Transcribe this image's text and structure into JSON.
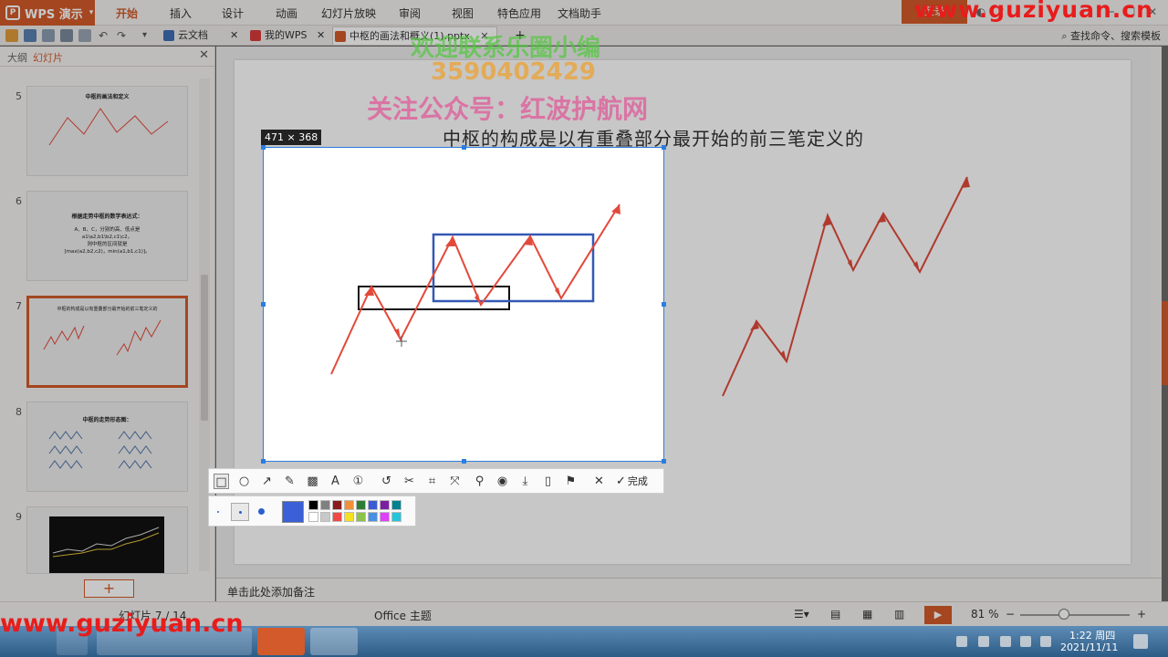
{
  "app": {
    "name": "WPS 演示"
  },
  "menu": {
    "items": [
      "开始",
      "插入",
      "设计",
      "动画",
      "幻灯片放映",
      "审阅",
      "视图",
      "特色应用",
      "文档助手"
    ],
    "login": "登录"
  },
  "tabs": {
    "cloud": "云文档",
    "mywps": "我的WPS",
    "current": "中枢的画法和概义(1).pptx",
    "search": "查找命令、搜索模板"
  },
  "panel": {
    "tab_outline": "大纲",
    "tab_slides": "幻灯片",
    "thumbs": [
      {
        "num": "5",
        "title": "中枢的画法和定义",
        "lines": []
      },
      {
        "num": "6",
        "title": "根据走势中枢的数学表达式：",
        "lines": [
          "A、B、C，分别的高、低点是",
          "a1\\a2,b1\\b2,c1\\c2，",
          "则中枢的区间就是",
          "[max(a2,b2,c2)，min(a1,b1,c1)]。"
        ]
      },
      {
        "num": "7",
        "title": "中枢的构成是以有重叠部分最开始的前三笔定义的",
        "lines": []
      },
      {
        "num": "8",
        "title": "中枢的走势形态图：",
        "lines": []
      },
      {
        "num": "9",
        "title": "",
        "lines": []
      }
    ]
  },
  "slide": {
    "title": "中枢的构成是以有重叠部分最开始的前三笔定义的"
  },
  "capture": {
    "size": "471 × 368",
    "done": "完成"
  },
  "watermarks": {
    "line1": "欢迎联系乐圈小编",
    "line2": "3590402429",
    "line3": "关注公众号：红波护航网",
    "site": "www.guziyuan.cn"
  },
  "notes": {
    "placeholder": "单击此处添加备注"
  },
  "status": {
    "slide_info": "幻灯片 7 / 14",
    "theme": "Office 主题",
    "zoom": "81 %"
  },
  "clock": {
    "time": "1:22 周四",
    "date": "2021/11/11"
  },
  "colors": {
    "accent": "#d35a2a",
    "arrow": "#e2493a",
    "box_blue": "#3558b6",
    "selection": "#2a7de1"
  },
  "palette": [
    "#000000",
    "#808080",
    "#8b1a1a",
    "#f0913a",
    "#2e7d32",
    "#3b5bd6",
    "#7b1fa2",
    "#00838f",
    "#ffffff",
    "#c8c8c8",
    "#f04848",
    "#f5e11e",
    "#8bc34a",
    "#4a90e2",
    "#e040fb",
    "#26c6da"
  ]
}
